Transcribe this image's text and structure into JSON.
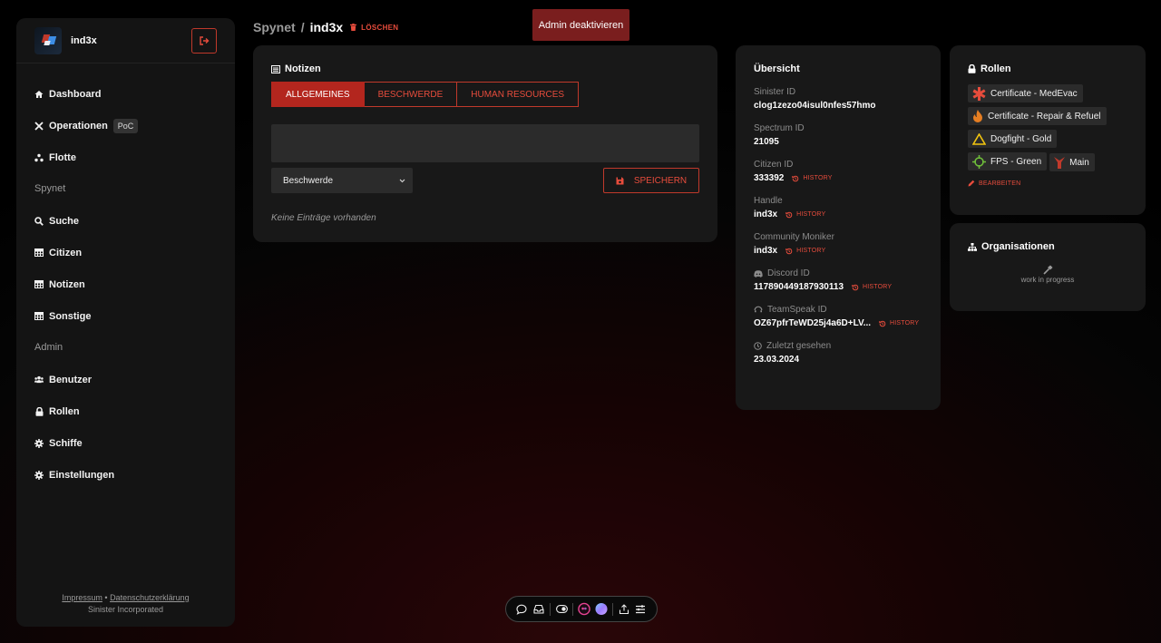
{
  "user": {
    "name": "ind3x"
  },
  "sidebar": {
    "items": [
      {
        "label": "Dashboard"
      },
      {
        "label": "Operationen",
        "badge": "PoC"
      },
      {
        "label": "Flotte"
      }
    ],
    "sections": [
      {
        "title": "Spynet",
        "items": [
          {
            "label": "Suche"
          },
          {
            "label": "Citizen"
          },
          {
            "label": "Notizen"
          },
          {
            "label": "Sonstige"
          }
        ]
      },
      {
        "title": "Admin",
        "items": [
          {
            "label": "Benutzer"
          },
          {
            "label": "Rollen"
          },
          {
            "label": "Schiffe"
          },
          {
            "label": "Einstellungen"
          }
        ]
      }
    ],
    "footer": {
      "impressum": "Impressum",
      "separator": "•",
      "privacy": "Datenschutzerklärung",
      "company": "Sinister Incorporated"
    }
  },
  "header": {
    "breadcrumb_root": "Spynet",
    "breadcrumb_sep": "/",
    "breadcrumb_current": "ind3x",
    "delete_label": "LÖSCHEN",
    "admin_button": "Admin deaktivieren"
  },
  "notes": {
    "title": "Notizen",
    "tabs": [
      {
        "label": "ALLGEMEINES",
        "active": true
      },
      {
        "label": "BESCHWERDE"
      },
      {
        "label": "HUMAN RESOURCES"
      }
    ],
    "textarea_value": "",
    "select_value": "Beschwerde",
    "save_label": "SPEICHERN",
    "empty_text": "Keine Einträge vorhanden"
  },
  "overview": {
    "title": "Übersicht",
    "history_label": "HISTORY",
    "fields": [
      {
        "label": "Sinister ID",
        "value": "clog1zezo04isul0nfes57hmo"
      },
      {
        "label": "Spectrum ID",
        "value": "21095"
      },
      {
        "label": "Citizen ID",
        "value": "333392"
      },
      {
        "label": "Handle",
        "value": "ind3x"
      },
      {
        "label": "Community Moniker",
        "value": "ind3x"
      },
      {
        "label": "Discord ID",
        "value": "117890449187930113"
      },
      {
        "label": "TeamSpeak ID",
        "value": "OZ67pfrTeWD25j4a6D+LV..."
      },
      {
        "label": "Zuletzt gesehen",
        "value": "23.03.2024"
      }
    ]
  },
  "roles": {
    "title": "Rollen",
    "items": [
      {
        "label": "Certificate - MedEvac",
        "icon": "medevac-icon",
        "color": "#e74c3c"
      },
      {
        "label": "Certificate - Repair & Refuel",
        "icon": "flame-icon",
        "color": "#e67e22"
      },
      {
        "label": "Dogfight - Gold",
        "icon": "triangle-icon",
        "color": "#f1c40f"
      },
      {
        "label": "FPS - Green",
        "icon": "crosshair-icon",
        "color": "#6fbf3a"
      },
      {
        "label": "Main",
        "icon": "sinister-logo-icon",
        "color": "#c0392b"
      }
    ],
    "edit_label": "BEARBEITEN"
  },
  "orgs": {
    "title": "Organisationen",
    "wip": "work in progress"
  },
  "colors": {
    "accent": "#c0392b",
    "accent_fill": "#b3261e",
    "card": "#181818",
    "panel": "#141414"
  }
}
